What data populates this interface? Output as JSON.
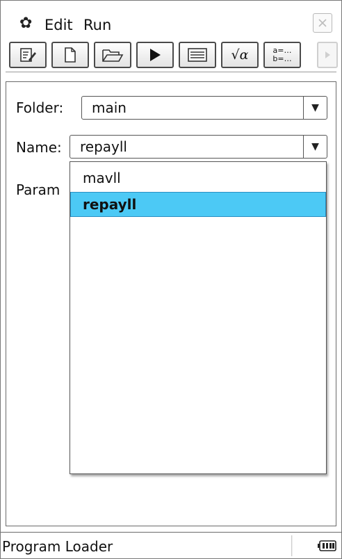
{
  "menubar": {
    "gear_icon": "gear-icon",
    "edit_label": "Edit",
    "run_label": "Run",
    "close_icon": "close-icon"
  },
  "toolbar": {
    "buttons": [
      {
        "name": "edit-program-icon"
      },
      {
        "name": "new-file-icon"
      },
      {
        "name": "open-folder-icon"
      },
      {
        "name": "run-icon"
      },
      {
        "name": "console-icon"
      },
      {
        "name": "sqrt-alpha-icon",
        "label": "√α"
      },
      {
        "name": "variables-icon",
        "label_top": "a=…",
        "label_bottom": "b=…"
      },
      {
        "name": "scroll-right-icon"
      }
    ]
  },
  "form": {
    "folder_label": "Folder:",
    "folder_value": "main",
    "name_label": "Name:",
    "name_value": "repayll",
    "param_label": "Param"
  },
  "dropdown": {
    "items": [
      {
        "label": "mavll",
        "selected": false
      },
      {
        "label": "repayll",
        "selected": true
      }
    ],
    "selected_color": "#4cc9f5"
  },
  "statusbar": {
    "title": "Program Loader",
    "battery_icon": "battery-icon"
  }
}
